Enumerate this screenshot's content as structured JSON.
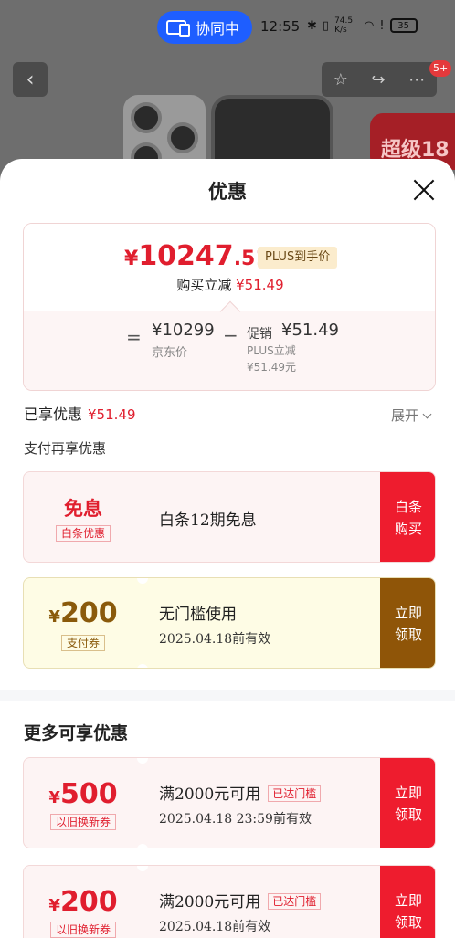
{
  "status_bar": {
    "collab_label": "协同中",
    "time": "12:55",
    "net_speed": "74.5 K/s",
    "battery": "35"
  },
  "top_nav": {
    "notification_badge": "5+",
    "promo_banner_text": "超级18"
  },
  "sheet": {
    "title": "优惠",
    "price_summary": {
      "currency": "¥",
      "final_integer": "10247",
      "final_decimal": ".51",
      "plus_tag": "PLUS到手价",
      "reduce_label": "购买立减",
      "reduce_amount": "¥51.49",
      "equals": "=",
      "minus": "−",
      "jd_price": "¥10299",
      "jd_price_label": "京东价",
      "promo_label": "促销",
      "promo_amount": "¥51.49",
      "plus_discount_label": "PLUS立减",
      "plus_discount_value": "¥51.49元"
    },
    "enjoyed_label": "已享优惠",
    "enjoyed_amount": "¥51.49",
    "expand_label": "展开",
    "payment_section_title": "支付再享优惠",
    "payment_coupons": [
      {
        "headline": "免息",
        "tag": "白条优惠",
        "title": "白条12期免息",
        "action": "白条\n购买",
        "accent": "#ee1c2e"
      },
      {
        "currency": "¥",
        "amount": "200",
        "tag": "支付券",
        "title": "无门槛使用",
        "date": "2025.04.18前有效",
        "action": "立即\n领取",
        "accent": "#8f5508"
      }
    ],
    "more_section_title": "更多可享优惠",
    "more_coupons": [
      {
        "currency": "¥",
        "amount": "500",
        "tag": "以旧换新券",
        "title": "满2000元可用",
        "reached": "已达门槛",
        "date": "2025.04.18 23:59前有效",
        "action": "立即\n领取"
      },
      {
        "currency": "¥",
        "amount": "200",
        "tag": "以旧换新券",
        "title": "满2000元可用",
        "reached": "已达门槛",
        "date": "2025.04.18前有效",
        "action": "立即\n领取"
      }
    ]
  }
}
